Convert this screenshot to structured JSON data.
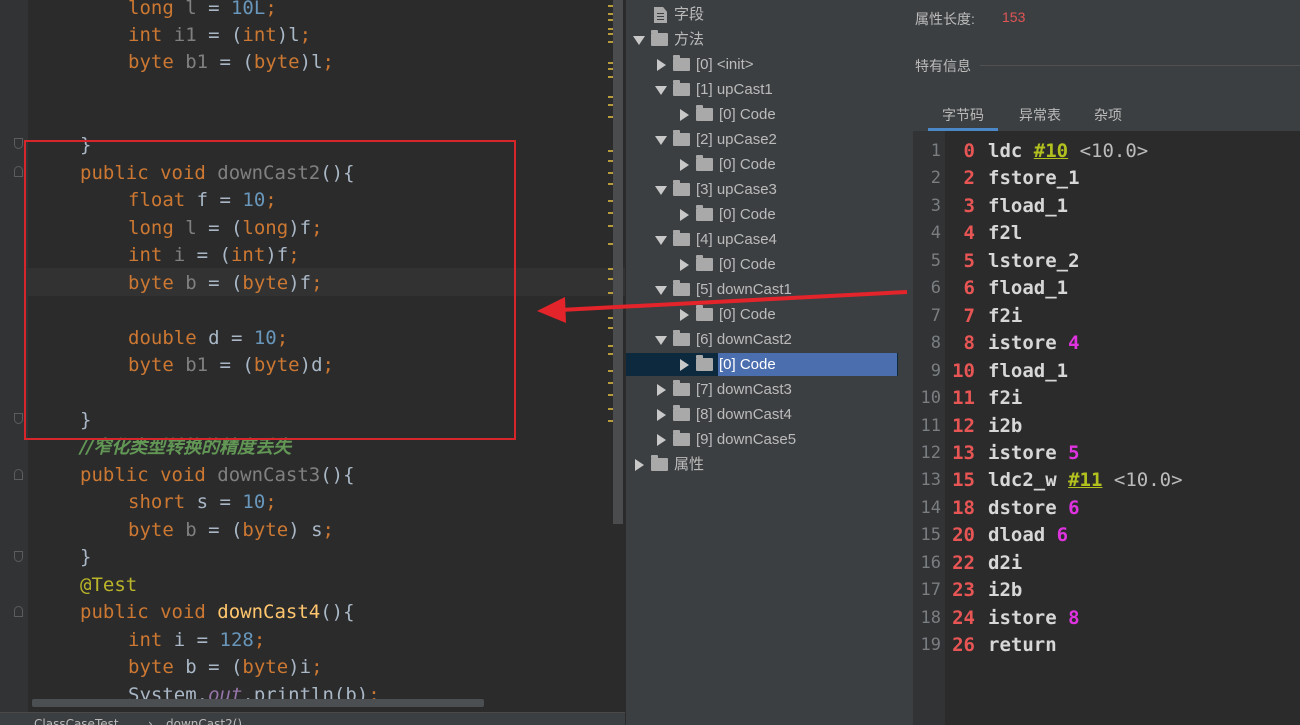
{
  "editor": {
    "lines": [
      {
        "parts": [
          {
            "t": "long ",
            "c": "kw"
          },
          {
            "t": "l",
            "c": "unused"
          },
          {
            "t": " = ",
            "c": ""
          },
          {
            "t": "10L",
            "c": "num"
          },
          {
            "t": ";",
            "c": "kw"
          }
        ]
      },
      {
        "parts": [
          {
            "t": "int ",
            "c": "kw"
          },
          {
            "t": "i1",
            "c": "unused"
          },
          {
            "t": " = (",
            "c": ""
          },
          {
            "t": "int",
            "c": "kw"
          },
          {
            "t": ")l",
            "c": ""
          },
          {
            "t": ";",
            "c": "kw"
          }
        ]
      },
      {
        "parts": [
          {
            "t": "byte ",
            "c": "kw"
          },
          {
            "t": "b1",
            "c": "unused"
          },
          {
            "t": " = (",
            "c": ""
          },
          {
            "t": "byte",
            "c": "kw"
          },
          {
            "t": ")l",
            "c": ""
          },
          {
            "t": ";",
            "c": "kw"
          }
        ]
      },
      {
        "parts": [
          {
            "t": "}",
            "c": ""
          }
        ]
      },
      {
        "parts": [
          {
            "t": "public void ",
            "c": "kw"
          },
          {
            "t": "downCast2",
            "c": "unused"
          },
          {
            "t": "(){",
            "c": ""
          }
        ]
      },
      {
        "parts": [
          {
            "t": "float ",
            "c": "kw"
          },
          {
            "t": "f = ",
            "c": ""
          },
          {
            "t": "10",
            "c": "num"
          },
          {
            "t": ";",
            "c": "kw"
          }
        ]
      },
      {
        "parts": [
          {
            "t": "long ",
            "c": "kw"
          },
          {
            "t": "l",
            "c": "unused"
          },
          {
            "t": " = (",
            "c": ""
          },
          {
            "t": "long",
            "c": "kw"
          },
          {
            "t": ")f",
            "c": ""
          },
          {
            "t": ";",
            "c": "kw"
          }
        ]
      },
      {
        "parts": [
          {
            "t": "int ",
            "c": "kw"
          },
          {
            "t": "i",
            "c": "unused"
          },
          {
            "t": " = (",
            "c": ""
          },
          {
            "t": "int",
            "c": "kw"
          },
          {
            "t": ")f",
            "c": ""
          },
          {
            "t": ";",
            "c": "kw"
          }
        ]
      },
      {
        "parts": [
          {
            "t": "byte ",
            "c": "kw"
          },
          {
            "t": "b",
            "c": "unused"
          },
          {
            "t": " = (",
            "c": ""
          },
          {
            "t": "byte",
            "c": "kw"
          },
          {
            "t": ")f",
            "c": ""
          },
          {
            "t": ";",
            "c": "kw"
          }
        ]
      },
      {
        "parts": [
          {
            "t": "double ",
            "c": "kw"
          },
          {
            "t": "d = ",
            "c": ""
          },
          {
            "t": "10",
            "c": "num"
          },
          {
            "t": ";",
            "c": "kw"
          }
        ]
      },
      {
        "parts": [
          {
            "t": "byte ",
            "c": "kw"
          },
          {
            "t": "b1",
            "c": "unused"
          },
          {
            "t": " = (",
            "c": ""
          },
          {
            "t": "byte",
            "c": "kw"
          },
          {
            "t": ")d",
            "c": ""
          },
          {
            "t": ";",
            "c": "kw"
          }
        ]
      },
      {
        "parts": [
          {
            "t": "}",
            "c": ""
          }
        ]
      },
      {
        "parts": [
          {
            "t": "//窄化类型转换的精度丢失",
            "c": "cmt"
          }
        ]
      },
      {
        "parts": [
          {
            "t": "public void ",
            "c": "kw"
          },
          {
            "t": "downCast3",
            "c": "unused"
          },
          {
            "t": "(){",
            "c": ""
          }
        ]
      },
      {
        "parts": [
          {
            "t": "short ",
            "c": "kw"
          },
          {
            "t": "s = ",
            "c": ""
          },
          {
            "t": "10",
            "c": "num"
          },
          {
            "t": ";",
            "c": "kw"
          }
        ]
      },
      {
        "parts": [
          {
            "t": "byte ",
            "c": "kw"
          },
          {
            "t": "b",
            "c": "unused"
          },
          {
            "t": " = (",
            "c": ""
          },
          {
            "t": "byte",
            "c": "kw"
          },
          {
            "t": ") s",
            "c": ""
          },
          {
            "t": ";",
            "c": "kw"
          }
        ]
      },
      {
        "parts": [
          {
            "t": "}",
            "c": ""
          }
        ]
      },
      {
        "parts": [
          {
            "t": "@Test",
            "c": "annot"
          }
        ]
      },
      {
        "parts": [
          {
            "t": "public void ",
            "c": "kw"
          },
          {
            "t": "downCast4",
            "c": "fnm"
          },
          {
            "t": "(){",
            "c": ""
          }
        ]
      },
      {
        "parts": [
          {
            "t": "int ",
            "c": "kw"
          },
          {
            "t": "i = ",
            "c": ""
          },
          {
            "t": "128",
            "c": "num"
          },
          {
            "t": ";",
            "c": "kw"
          }
        ]
      },
      {
        "parts": [
          {
            "t": "byte ",
            "c": "kw"
          },
          {
            "t": "b = (",
            "c": ""
          },
          {
            "t": "byte",
            "c": "kw"
          },
          {
            "t": ")i",
            "c": ""
          },
          {
            "t": ";",
            "c": "kw"
          }
        ]
      },
      {
        "parts": [
          {
            "t": "System.",
            "c": ""
          },
          {
            "t": "out",
            "c": "stat"
          },
          {
            "t": ".println(b)",
            "c": ""
          },
          {
            "t": ";",
            "c": "kw"
          }
        ]
      }
    ],
    "breadcrumb": [
      "ClassCaseTest",
      "downCast2()"
    ]
  },
  "tree": {
    "nodes": [
      {
        "label": "字段",
        "arrow": "none",
        "icon": "doc-icon"
      },
      {
        "label": "方法",
        "arrow": "down",
        "icon": "folder-icon"
      },
      {
        "label": "[0] <init>",
        "arrow": "right",
        "icon": "folder-icon"
      },
      {
        "label": "[1] upCast1",
        "arrow": "down",
        "icon": "folder-icon"
      },
      {
        "label": "[0] Code",
        "arrow": "right",
        "icon": "folder-icon"
      },
      {
        "label": "[2] upCase2",
        "arrow": "down",
        "icon": "folder-icon"
      },
      {
        "label": "[0] Code",
        "arrow": "right",
        "icon": "folder-icon"
      },
      {
        "label": "[3] upCase3",
        "arrow": "down",
        "icon": "folder-icon"
      },
      {
        "label": "[0] Code",
        "arrow": "right",
        "icon": "folder-icon"
      },
      {
        "label": "[4] upCase4",
        "arrow": "down",
        "icon": "folder-icon"
      },
      {
        "label": "[0] Code",
        "arrow": "right",
        "icon": "folder-icon"
      },
      {
        "label": "[5] downCast1",
        "arrow": "down",
        "icon": "folder-icon"
      },
      {
        "label": "[0] Code",
        "arrow": "right",
        "icon": "folder-icon"
      },
      {
        "label": "[6] downCast2",
        "arrow": "down",
        "icon": "folder-icon"
      },
      {
        "label": "[0] Code",
        "arrow": "right",
        "icon": "folder-icon",
        "selected": true
      },
      {
        "label": "[7] downCast3",
        "arrow": "right",
        "icon": "folder-icon"
      },
      {
        "label": "[8] downCast4",
        "arrow": "right",
        "icon": "folder-icon"
      },
      {
        "label": "[9] downCase5",
        "arrow": "right",
        "icon": "folder-icon"
      },
      {
        "label": "属性",
        "arrow": "right",
        "icon": "folder-icon"
      }
    ]
  },
  "info": {
    "attr_length_label": "属性长度:",
    "attr_length_value": "153",
    "special_info_label": "特有信息",
    "tabs": [
      "字节码",
      "异常表",
      "杂项"
    ],
    "bytecode": [
      {
        "ln": "1",
        "off": "0",
        "op": "ldc",
        "ref": "#10",
        "comment": "<10.0>"
      },
      {
        "ln": "2",
        "off": "2",
        "op": "fstore_1"
      },
      {
        "ln": "3",
        "off": "3",
        "op": "fload_1"
      },
      {
        "ln": "4",
        "off": "4",
        "op": "f2l"
      },
      {
        "ln": "5",
        "off": "5",
        "op": "lstore_2"
      },
      {
        "ln": "6",
        "off": "6",
        "op": "fload_1"
      },
      {
        "ln": "7",
        "off": "7",
        "op": "f2i"
      },
      {
        "ln": "8",
        "off": "8",
        "op": "istore",
        "arg": "4"
      },
      {
        "ln": "9",
        "off": "10",
        "op": "fload_1"
      },
      {
        "ln": "10",
        "off": "11",
        "op": "f2i"
      },
      {
        "ln": "11",
        "off": "12",
        "op": "i2b"
      },
      {
        "ln": "12",
        "off": "13",
        "op": "istore",
        "arg": "5"
      },
      {
        "ln": "13",
        "off": "15",
        "op": "ldc2_w",
        "ref": "#11",
        "comment": "<10.0>"
      },
      {
        "ln": "14",
        "off": "18",
        "op": "dstore",
        "arg": "6"
      },
      {
        "ln": "15",
        "off": "20",
        "op": "dload",
        "arg": "6"
      },
      {
        "ln": "16",
        "off": "22",
        "op": "d2i"
      },
      {
        "ln": "17",
        "off": "23",
        "op": "i2b"
      },
      {
        "ln": "18",
        "off": "24",
        "op": "istore",
        "arg": "8"
      },
      {
        "ln": "19",
        "off": "26",
        "op": "return"
      }
    ]
  },
  "colors": {
    "keyword": "#cc7832",
    "number": "#6897bb",
    "selection": "#4b6eaf",
    "annotation_box": "#d6262b",
    "offset": "#e85555",
    "arg": "#e033e0",
    "constant_ref": "#b3c11f"
  }
}
